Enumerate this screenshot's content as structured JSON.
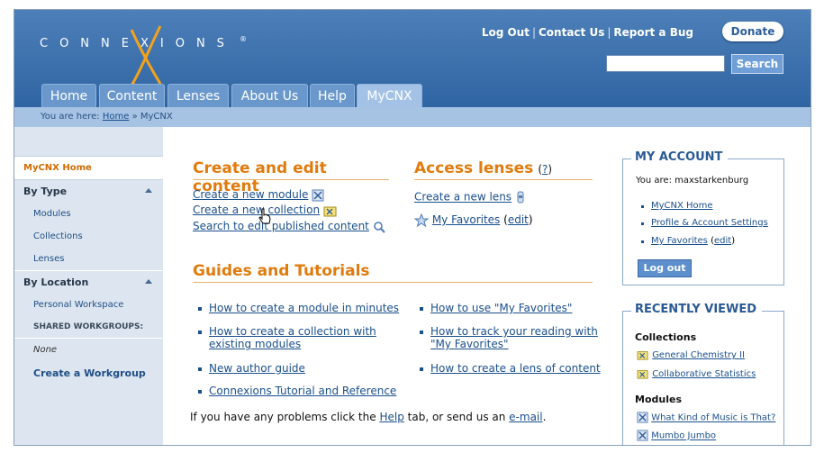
{
  "header": {
    "logo_text": "CONNEXIONS",
    "top_links": [
      "Log Out",
      "Contact Us",
      "Report a Bug"
    ],
    "donate_label": "Donate",
    "search_button": "Search",
    "tabs": [
      "Home",
      "Content",
      "Lenses",
      "About Us",
      "Help",
      "MyCNX"
    ],
    "active_tab": "MyCNX"
  },
  "breadcrumb": {
    "prefix": "You are here:",
    "home": "Home",
    "sep": "»",
    "current": "MyCNX"
  },
  "sidebar": {
    "home": "MyCNX Home",
    "by_type": "By Type",
    "type_items": [
      "Modules",
      "Collections",
      "Lenses"
    ],
    "by_location": "By Location",
    "personal_workspace": "Personal Workspace",
    "shared_workgroups": "SHARED WORKGROUPS:",
    "none_label": "None",
    "create_workgroup": "Create a Workgroup"
  },
  "main": {
    "create_title": "Create and edit content",
    "create_links": [
      "Create a new module",
      "Create a new collection",
      "Search to edit published content"
    ],
    "lenses_title": "Access lenses",
    "lenses_help": "?",
    "create_lens": "Create a new lens",
    "my_favorites": "My Favorites",
    "edit": "edit",
    "guides_title": "Guides and Tutorials",
    "guides_left": [
      "How to create a module in minutes",
      "How to create a collection with",
      "existing modules",
      "New author guide",
      "Connexions Tutorial and Reference"
    ],
    "guides_right": [
      "How to use \"My Favorites\"",
      "How to track your reading with",
      "\"My Favorites\"",
      "How to create a lens of content"
    ],
    "help_note_pre": "If you have any problems click the",
    "help_note_help": "Help",
    "help_note_mid": "tab, or send us an",
    "help_note_email": "e-mail",
    "help_note_end": "."
  },
  "account": {
    "title": "MY ACCOUNT",
    "you_are": "You are: maxstarkenburg",
    "links": [
      "MyCNX Home",
      "Profile & Account Settings",
      "My Favorites"
    ],
    "edit": "edit",
    "logout": "Log out"
  },
  "recent": {
    "title": "RECENTLY VIEWED",
    "collections_head": "Collections",
    "collections": [
      "General Chemistry II",
      "Collaborative Statistics"
    ],
    "modules_head": "Modules",
    "modules": [
      "What Kind of Music is That?",
      "Mumbo Jumbo"
    ]
  },
  "colors": {
    "header_blue": "#3a6fae",
    "accent_orange": "#e07b0d",
    "link_blue": "#1a4f8c"
  },
  "icons": [
    "module-icon",
    "collection-icon",
    "search-icon",
    "lens-icon",
    "star-icon",
    "hand-cursor-icon"
  ]
}
